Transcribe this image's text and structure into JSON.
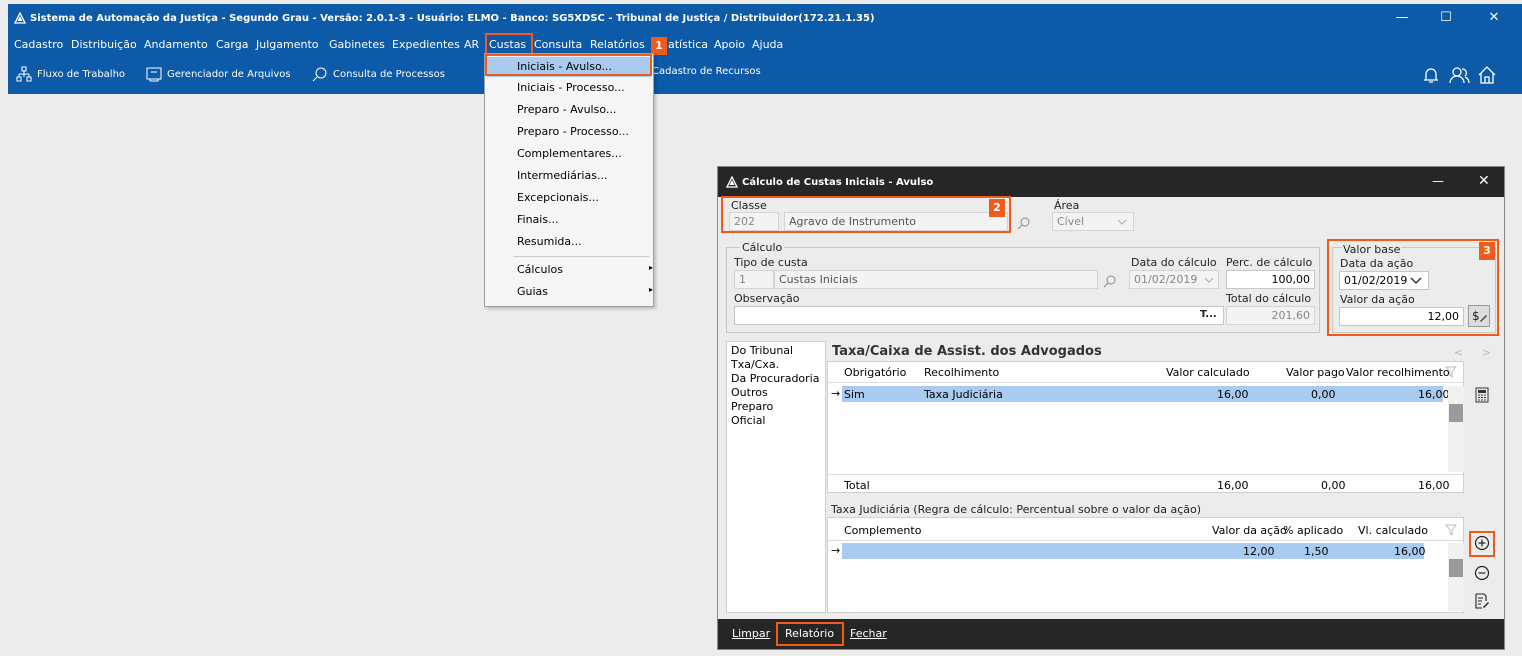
{
  "window": {
    "title": "Sistema de Automação da Justiça - Segundo Grau - Versão: 2.0.1-3 - Usuário: ELMO - Banco: SG5XDSC - Tribunal de Justiça / Distribuidor(172.21.1.35)",
    "minimize": "—",
    "maximize": "☐",
    "close": "✕"
  },
  "menu": [
    "Cadastro",
    "Distribuição",
    "Andamento",
    "Carga",
    "Julgamento",
    "Gabinetes",
    "Expedientes",
    "AR",
    "Custas",
    "Consulta",
    "Relatórios",
    "Estatística",
    "Apoio",
    "Ajuda"
  ],
  "menu_hidden_part": "atística",
  "toolbar": {
    "fluxo": "Fluxo de Trabalho",
    "gerenciador": "Gerenciador de Arquivos",
    "consulta": "Consulta de Processos",
    "cadastro_recursos": "Cadastro de Recursos"
  },
  "badges": [
    "1",
    "2",
    "3"
  ],
  "custas_menu": {
    "items": [
      "Iniciais - Avulso...",
      "Iniciais - Processo...",
      "Preparo - Avulso...",
      "Preparo - Processo...",
      "Complementares...",
      "Intermediárias...",
      "Excepcionais...",
      "Finais...",
      "Resumida..."
    ],
    "submenus": [
      "Cálculos",
      "Guias"
    ],
    "submenu_arrow": "▸"
  },
  "dialog": {
    "title": "Cálculo de Custas Iniciais - Avulso",
    "minimize": "—",
    "close": "✕",
    "classe": {
      "label": "Classe",
      "code": "202",
      "name": "Agravo de Instrumento"
    },
    "area": {
      "label": "Área",
      "value": "Cível"
    },
    "calculo": {
      "group_label": "Cálculo",
      "tipo_label": "Tipo de custa",
      "tipo_code": "1",
      "tipo_name": "Custas Iniciais",
      "data_calc_label": "Data do cálculo",
      "data_calc_value": "01/02/2019",
      "perc_label": "Perc. de cálculo",
      "perc_value": "100,00",
      "obs_label": "Observação",
      "obs_button": "T...",
      "total_label": "Total do cálculo",
      "total_value": "201,60"
    },
    "valor_base": {
      "group_label": "Valor base",
      "data_acao_label": "Data da ação",
      "data_acao_value": "01/02/2019",
      "valor_acao_label": "Valor da ação",
      "valor_acao_value": "12,00"
    },
    "categories": [
      "Do Tribunal",
      "Txa/Cxa.",
      "Da Procuradoria",
      "Outros",
      "Preparo",
      "Oficial"
    ],
    "section_title": "Taxa/Caixa de Assist. dos Advogados",
    "nav_prev": "<",
    "nav_next": ">",
    "grid1": {
      "headers": [
        "Obrigatório",
        "Recolhimento",
        "Valor calculado",
        "Valor pago",
        "Valor recolhimento"
      ],
      "rows": [
        {
          "obrigatorio": "Sim",
          "recolhimento": "Taxa Judiciária",
          "calculado": "16,00",
          "pago": "0,00",
          "recolhimento_valor": "16,00"
        }
      ],
      "total_label": "Total",
      "totals": {
        "calculado": "16,00",
        "pago": "0,00",
        "recolhimento": "16,00"
      }
    },
    "subtitle": "Taxa Judiciária (Regra de cálculo: Percentual sobre o valor da ação)",
    "grid2": {
      "headers": [
        "Complemento",
        "Valor da ação",
        "% aplicado",
        "Vl. calculado"
      ],
      "rows": [
        {
          "complemento": "",
          "valor_acao": "12,00",
          "aplicado": "1,50",
          "calculado": "16,00"
        }
      ]
    },
    "row_marker": "→",
    "footer": {
      "limpar": "Limpar",
      "relatorio": "Relatório",
      "fechar": "Fechar"
    }
  }
}
